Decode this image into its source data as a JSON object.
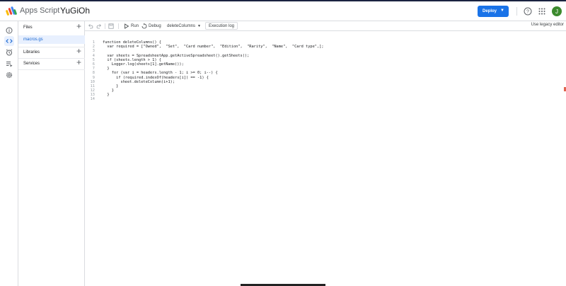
{
  "header": {
    "app_name": "Apps Script",
    "project_name": "YuGiOh",
    "deploy_label": "Deploy",
    "avatar_letter": "J"
  },
  "rail": {
    "icons": [
      "overview-icon",
      "editor-icon",
      "triggers-icon",
      "executions-icon",
      "settings-icon"
    ]
  },
  "files_panel": {
    "files_label": "Files",
    "files": [
      "macros.gs"
    ],
    "libraries_label": "Libraries",
    "services_label": "Services"
  },
  "toolbar": {
    "run_label": "Run",
    "debug_label": "Debug",
    "function_select": "deleteColumns",
    "exec_log_label": "Execution log",
    "legacy_label": "Use legacy editor"
  },
  "code": {
    "lines": [
      {
        "n": "1",
        "t": "function deleteColumns() {"
      },
      {
        "n": "2",
        "t": "  var required = [\"Owned\",  \"Set\",  \"Card number\",  \"Edition\",  \"Rarity\",  \"Name\",  \"Card type\",];"
      },
      {
        "n": "3",
        "t": ""
      },
      {
        "n": "4",
        "t": "  var sheets = SpreadsheetApp.getActiveSpreadsheet().getSheets();"
      },
      {
        "n": "5",
        "t": "  if (sheets.length > 1) {"
      },
      {
        "n": "6",
        "t": "    Logger.log(sheets[1].getName());"
      },
      {
        "n": "7",
        "t": "  }"
      },
      {
        "n": "8",
        "t": "    for (var i = headers.length - 1; i >= 0; i--) {"
      },
      {
        "n": "9",
        "t": "      if (required.indexOf(headers[i]) == -1) {"
      },
      {
        "n": "10",
        "t": "        sheet.deleteColumn(i+1);"
      },
      {
        "n": "11",
        "t": "      }"
      },
      {
        "n": "12",
        "t": "    }"
      },
      {
        "n": "13",
        "t": "  }"
      },
      {
        "n": "14",
        "t": ""
      }
    ]
  },
  "colors": {
    "accent": "#1a73e8",
    "avatar": "#3c8a2e",
    "selected_file_bg": "#e8f0fe"
  }
}
